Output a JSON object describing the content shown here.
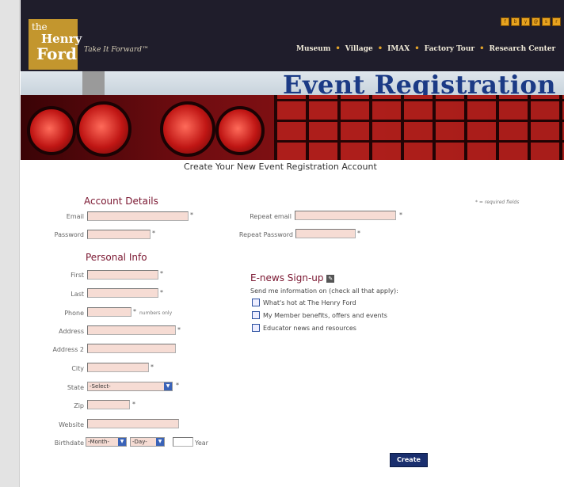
{
  "header": {
    "logo_line1": "the",
    "logo_line2": "Henry",
    "logo_line3": "Ford",
    "tagline": "Take It Forward™",
    "nav": [
      "Museum",
      "Village",
      "IMAX",
      "Factory Tour",
      "Research Center"
    ],
    "nav_separator": "•",
    "banner_title": "Event Registration"
  },
  "form": {
    "title": "Create Your New Event Registration Account",
    "required_note": "* = required fields",
    "account_heading": "Account Details",
    "personal_heading": "Personal Info",
    "labels": {
      "email": "Email",
      "password": "Password",
      "repeat_email": "Repeat email",
      "repeat_password": "Repeat Password",
      "first": "First",
      "last": "Last",
      "phone": "Phone",
      "address": "Address",
      "address2": "Address 2",
      "city": "City",
      "state": "State",
      "zip": "Zip",
      "website": "Website",
      "birthdate": "Birthdate",
      "year": "Year"
    },
    "phone_hint": "numbers only",
    "required_mark": "*",
    "state_select": "-Select-",
    "month_select": "-Month-",
    "day_select": "-Day-",
    "create_button": "Create"
  },
  "enews": {
    "heading": "E-news Sign-up",
    "prompt": "Send me information on (check all that apply):",
    "options": [
      "What's hot at The Henry Ford",
      "My Member benefits, offers and events",
      "Educator news and resources"
    ]
  }
}
